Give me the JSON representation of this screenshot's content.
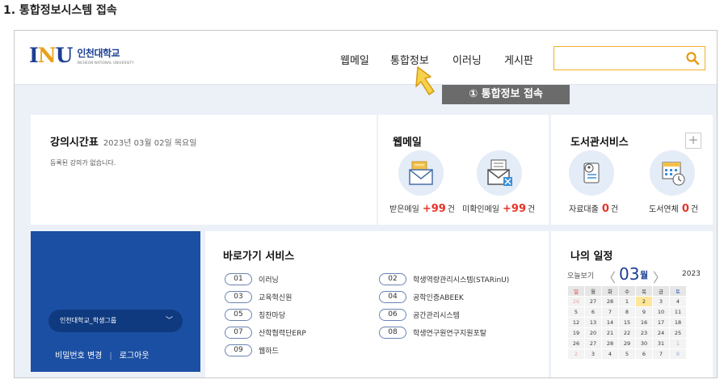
{
  "doc_heading": "1. 통합정보시스템 접속",
  "logo": {
    "mark_i": "I",
    "mark_n": "N",
    "mark_u": "U",
    "name_ko": "인천대학교",
    "name_en": "INCHEON NATIONAL UNIVERSITY"
  },
  "nav": [
    "웹메일",
    "통합정보",
    "이러닝",
    "게시판"
  ],
  "search": {
    "placeholder": ""
  },
  "callout": "① 통합정보 접속",
  "timetable": {
    "title": "강의시간표",
    "date": "2023년 03월 02일 목요일",
    "empty": "등록된 강의가 없습니다."
  },
  "webmail": {
    "title": "웹메일",
    "received_label": "받은메일",
    "received_count": "+99",
    "unread_label": "미확인메일",
    "unread_count": "+99",
    "unit": "건"
  },
  "library": {
    "title": "도서관서비스",
    "plus": "+",
    "loan_label": "자료대출",
    "loan_count": "0",
    "overdue_label": "도서연체",
    "overdue_count": "0",
    "unit": "건"
  },
  "account": {
    "group": "인천대학교_학생그룹",
    "change_pw": "비밀번호 변경",
    "divider": "|",
    "logout": "로그아웃"
  },
  "shortcuts": {
    "title": "바로가기 서비스",
    "items": [
      {
        "no": "01",
        "label": "이러닝"
      },
      {
        "no": "02",
        "label": "학생역량관리시스템(STARinU)"
      },
      {
        "no": "03",
        "label": "교육혁신원"
      },
      {
        "no": "04",
        "label": "공학인증ABEEK"
      },
      {
        "no": "05",
        "label": "칭찬마당"
      },
      {
        "no": "06",
        "label": "공간관리시스템"
      },
      {
        "no": "07",
        "label": "산학협력단ERP"
      },
      {
        "no": "08",
        "label": "학생연구원연구지원포탈"
      },
      {
        "no": "09",
        "label": "웹하드"
      }
    ]
  },
  "schedule": {
    "title": "나의 일정",
    "today_label": "오늘보기",
    "prev": "〈",
    "next": "〉",
    "month": "03",
    "month_unit": "월",
    "year": "2023",
    "weekdays": [
      "일",
      "월",
      "화",
      "수",
      "목",
      "금",
      "토"
    ],
    "weeks": [
      [
        "26",
        "27",
        "28",
        "1",
        "2",
        "3",
        "4"
      ],
      [
        "5",
        "6",
        "7",
        "8",
        "9",
        "10",
        "11"
      ],
      [
        "12",
        "13",
        "14",
        "15",
        "16",
        "17",
        "18"
      ],
      [
        "19",
        "20",
        "21",
        "22",
        "23",
        "24",
        "25"
      ],
      [
        "26",
        "27",
        "28",
        "29",
        "30",
        "31",
        "1"
      ],
      [
        "2",
        "3",
        "4",
        "5",
        "6",
        "7",
        "8"
      ]
    ]
  }
}
